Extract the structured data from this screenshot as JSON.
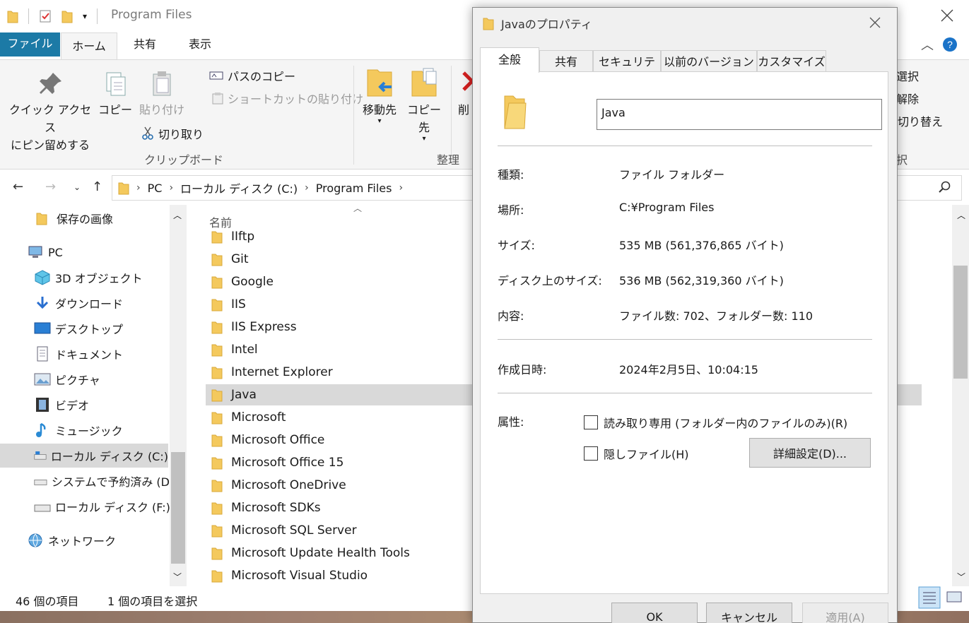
{
  "explorer": {
    "title": "Program Files",
    "ribbon_tabs": {
      "file": "ファイル",
      "home": "ホーム",
      "share": "共有",
      "view": "表示"
    },
    "ribbon": {
      "pin_quick_access": "クイック アクセス",
      "pin_quick_access_2": "にピン留めする",
      "copy": "コピー",
      "paste": "貼り付け",
      "copy_path": "パスのコピー",
      "paste_shortcut": "ショートカットの貼り付け",
      "cut": "切り取り",
      "clipboard_group": "クリップボード",
      "move_to": "移動先",
      "copy_to": "コピー先",
      "delete_partial": "削",
      "organize_group": "整理",
      "select_partial_1": "選択",
      "select_partial_2": "解除",
      "select_partial_3": "切り替え",
      "select_group_partial": "択"
    },
    "address": {
      "segments": [
        "PC",
        "ローカル ディスク (C:)",
        "Program Files"
      ]
    },
    "nav_pane": {
      "items": [
        {
          "label": "保存の画像",
          "icon": "folder-icon"
        },
        {
          "label": "PC",
          "icon": "pc-icon"
        },
        {
          "label": "3D オブジェクト",
          "icon": "3d-objects-icon"
        },
        {
          "label": "ダウンロード",
          "icon": "download-icon"
        },
        {
          "label": "デスクトップ",
          "icon": "desktop-icon"
        },
        {
          "label": "ドキュメント",
          "icon": "documents-icon"
        },
        {
          "label": "ピクチャ",
          "icon": "pictures-icon"
        },
        {
          "label": "ビデオ",
          "icon": "videos-icon"
        },
        {
          "label": "ミュージック",
          "icon": "music-icon"
        },
        {
          "label": "ローカル ディスク (C:)",
          "icon": "drive-icon"
        },
        {
          "label": "システムで予約済み (D",
          "icon": "drive-icon"
        },
        {
          "label": "ローカル ディスク (F:)",
          "icon": "drive-icon"
        },
        {
          "label": "ネットワーク",
          "icon": "network-icon"
        }
      ]
    },
    "file_list": {
      "column_name": "名前",
      "items": [
        "IIftp",
        "Git",
        "Google",
        "IIS",
        "IIS Express",
        "Intel",
        "Internet Explorer",
        "Java",
        "Microsoft",
        "Microsoft Office",
        "Microsoft Office 15",
        "Microsoft OneDrive",
        "Microsoft SDKs",
        "Microsoft SQL Server",
        "Microsoft Update Health Tools",
        "Microsoft Visual Studio"
      ]
    },
    "status": {
      "item_count": "46 個の項目",
      "selected_count": "1 個の項目を選択"
    }
  },
  "dialog": {
    "title": "Javaのプロパティ",
    "tabs": [
      "全般",
      "共有",
      "セキュリティ",
      "以前のバージョン",
      "カスタマイズ"
    ],
    "folder_name": "Java",
    "type_label": "種類:",
    "type_value": "ファイル フォルダー",
    "location_label": "場所:",
    "location_value": "C:¥Program Files",
    "size_label": "サイズ:",
    "size_value": "535 MB (561,376,865 バイト)",
    "disk_size_label": "ディスク上のサイズ:",
    "disk_size_value": "536 MB (562,319,360 バイト)",
    "contents_label": "内容:",
    "contents_value": "ファイル数: 702、フォルダー数: 110",
    "created_label": "作成日時:",
    "created_value": "2024年2月5日、10:04:15",
    "attributes_label": "属性:",
    "readonly_label": "読み取り専用 (フォルダー内のファイルのみ)(R)",
    "hidden_label": "隠しファイル(H)",
    "advanced_button": "詳細設定(D)...",
    "ok_button": "OK",
    "cancel_button": "キャンセル",
    "apply_button": "適用(A)"
  },
  "colors": {
    "accent": "#1c7aa6",
    "folder": "#f4c95d",
    "selected": "#d9d9d9"
  }
}
